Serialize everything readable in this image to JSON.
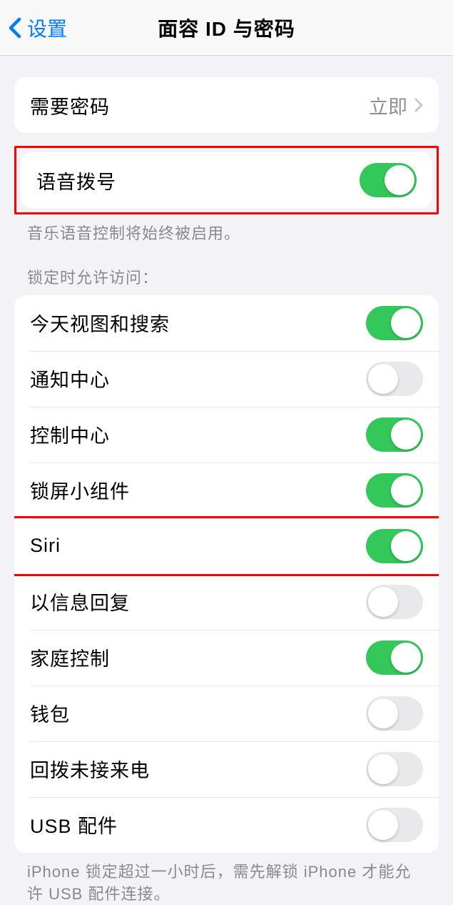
{
  "nav": {
    "back_label": "设置",
    "title": "面容 ID 与密码"
  },
  "require_passcode": {
    "label": "需要密码",
    "value": "立即"
  },
  "voice_dial": {
    "label": "语音拨号",
    "on": true,
    "footer": "音乐语音控制将始终被启用。"
  },
  "lock_access": {
    "header": "锁定时允许访问：",
    "items": [
      {
        "label": "今天视图和搜索",
        "on": true
      },
      {
        "label": "通知中心",
        "on": false
      },
      {
        "label": "控制中心",
        "on": true
      },
      {
        "label": "锁屏小组件",
        "on": true
      },
      {
        "label": "Siri",
        "on": true
      },
      {
        "label": "以信息回复",
        "on": false
      },
      {
        "label": "家庭控制",
        "on": true
      },
      {
        "label": "钱包",
        "on": false
      },
      {
        "label": "回拨未接来电",
        "on": false
      },
      {
        "label": "USB 配件",
        "on": false
      }
    ],
    "footer": "iPhone 锁定超过一小时后，需先解锁 iPhone 才能允许 USB 配件连接。"
  }
}
